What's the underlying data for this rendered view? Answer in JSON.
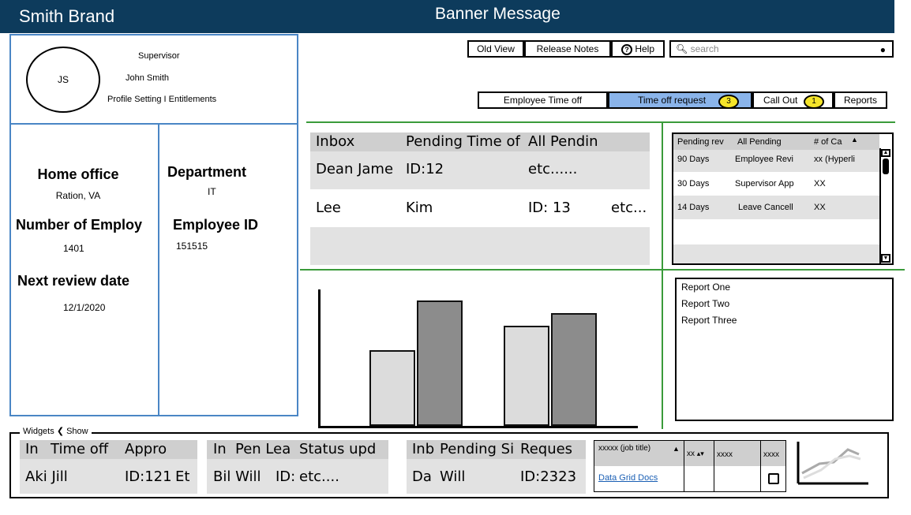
{
  "header": {
    "brand": "Smith Brand",
    "banner": "Banner Message",
    "bar_color": "#0d3b5c"
  },
  "toolbar": {
    "old_view": "Old View",
    "release_notes": "Release Notes",
    "help": "Help",
    "search_placeholder": "search"
  },
  "tabs": {
    "employee_time_off": "Employee Time off",
    "time_off_request": "Time off request",
    "time_off_badge": "3",
    "call_out": "Call Out",
    "call_out_badge": "1",
    "reports": "Reports"
  },
  "profile": {
    "initials": "JS",
    "role": "Supervisor",
    "name": "John Smith",
    "links": "Profile Setting I Entitlements"
  },
  "details": {
    "home_office_label": "Home office",
    "home_office_value": "Ration, VA",
    "department_label": "Department",
    "department_value": "IT",
    "num_employ_label": "Number of Employ",
    "num_employ_value": "1401",
    "employee_id_label": "Employee ID",
    "employee_id_value": "151515",
    "next_review_label": "Next review date",
    "next_review_value": "12/1/2020"
  },
  "inbox": {
    "headers": [
      "Inbox",
      "Pending Time of",
      "All Pendin"
    ],
    "row1": [
      "Dean Jame",
      "ID:12",
      "etc......"
    ],
    "row2": [
      "Lee",
      "Kim",
      "ID: 13",
      "etc..."
    ]
  },
  "pending": {
    "headers": [
      "Pending rev",
      "All Pending",
      "# of Ca"
    ],
    "rows": [
      [
        "90 Days",
        "Employee Revi",
        "xx (Hyperli"
      ],
      [
        "30 Days",
        "Supervisor App",
        "XX"
      ],
      [
        "14 Days",
        "Leave Cancell",
        "XX"
      ]
    ]
  },
  "reports": {
    "items": [
      "Report One",
      "Report Two",
      "Report Three"
    ]
  },
  "chart_data": {
    "type": "bar",
    "series": [
      {
        "values": [
          3,
          4
        ]
      },
      {
        "values": [
          5,
          4.5
        ]
      }
    ],
    "categories": [
      "",
      ""
    ]
  },
  "widgets": {
    "legend": "Widgets",
    "show": "Show",
    "w1_headers": [
      "In",
      "Time off",
      "Appro"
    ],
    "w1_row": [
      "Aki Jill",
      "ID:121",
      "Et"
    ],
    "w2_headers": [
      "In",
      "Pen Lea",
      "Status upd"
    ],
    "w2_row": [
      "Bil Will",
      "ID:",
      "etc...."
    ],
    "w3_headers": [
      "Inb",
      "Pending Si",
      "Reques"
    ],
    "w3_row": [
      "Da",
      "Will",
      "ID:2323"
    ],
    "grid_header": [
      "xxxxx (job title)",
      "xx",
      "xxxx",
      "xxxx"
    ],
    "grid_link": "Data Grid Docs"
  }
}
